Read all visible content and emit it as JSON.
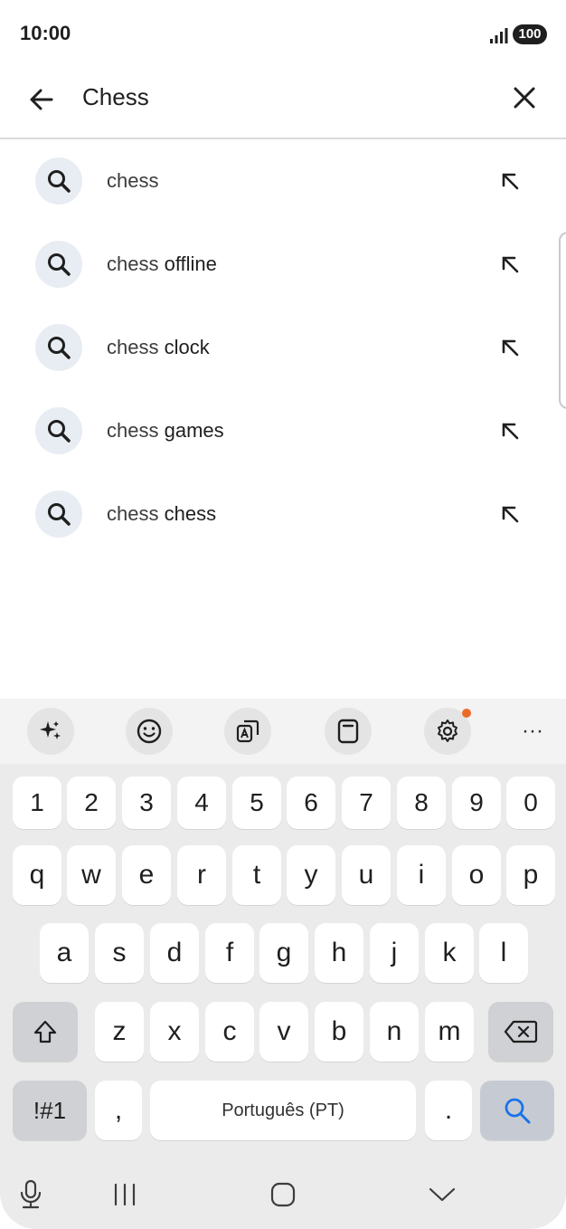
{
  "status_bar": {
    "time": "10:00",
    "battery": "100"
  },
  "search": {
    "query": "Chess"
  },
  "suggestions": [
    {
      "prefix": "chess",
      "suffix": ""
    },
    {
      "prefix": "chess",
      "suffix": " offline"
    },
    {
      "prefix": "chess",
      "suffix": " clock"
    },
    {
      "prefix": "chess",
      "suffix": " games"
    },
    {
      "prefix": "chess",
      "suffix": " chess"
    }
  ],
  "keyboard": {
    "row_numbers": [
      "1",
      "2",
      "3",
      "4",
      "5",
      "6",
      "7",
      "8",
      "9",
      "0"
    ],
    "row_1": [
      "q",
      "w",
      "e",
      "r",
      "t",
      "y",
      "u",
      "i",
      "o",
      "p"
    ],
    "row_2": [
      "a",
      "s",
      "d",
      "f",
      "g",
      "h",
      "j",
      "k",
      "l"
    ],
    "row_3": [
      "z",
      "x",
      "c",
      "v",
      "b",
      "n",
      "m"
    ],
    "symbols_label": "!#1",
    "comma": ",",
    "space_label": "Português (PT)",
    "period": ".",
    "more_label": "···"
  },
  "colors": {
    "accent": "#1a73e8",
    "notification_dot": "#ea6a2a"
  }
}
